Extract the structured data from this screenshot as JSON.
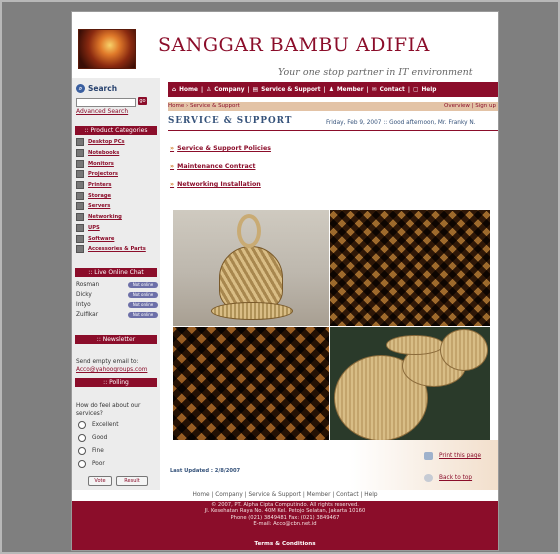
{
  "site": {
    "title": "SANGGAR BAMBU ADIFIA",
    "tagline": "Your one stop partner in IT environment"
  },
  "search": {
    "label": "Search",
    "go_label": "go",
    "advanced_label": "Advanced Search"
  },
  "categories": {
    "heading": ":: Product Categories",
    "items": [
      "Desktop PCs",
      "Notebooks",
      "Monitors",
      "Projectors",
      "Printers",
      "Storage",
      "Servers",
      "Networking",
      "UPS",
      "Software",
      "Accessories & Parts"
    ]
  },
  "chat": {
    "heading": ":: Live Online Chat",
    "users": [
      {
        "name": "Rosman",
        "status": "Not online"
      },
      {
        "name": "Dicky",
        "status": "Not online"
      },
      {
        "name": "Intyo",
        "status": "Not online"
      },
      {
        "name": "Zulfikar",
        "status": "Not online"
      }
    ]
  },
  "newsletter": {
    "heading": ":: Newsletter",
    "text": "Send empty email to:",
    "email": "Acco@yahoogroups.com"
  },
  "poll": {
    "heading": ":: Polling",
    "question": "How do feel about our services?",
    "options": [
      "Excellent",
      "Good",
      "Fine",
      "Poor"
    ],
    "vote_label": "Vote",
    "result_label": "Result"
  },
  "nav": {
    "items": [
      "Home",
      "Company",
      "Service & Support",
      "Member",
      "Contact",
      "Help"
    ]
  },
  "breadcrumb": {
    "home": "Home",
    "current": "Service & Support",
    "right": "Overview | Sign up"
  },
  "section": {
    "title": "SERVICE & SUPPORT",
    "date_line": "Friday, Feb 9, 2007 :: Good afternoon, Mr. Franky N.",
    "links": [
      "Service & Support Policies",
      "Maintenance Contract",
      "Networking Installation"
    ]
  },
  "page_footer": {
    "last_updated": "Last Updated : 2/8/2007",
    "print_label": "Print this page",
    "top_label": "Back to top"
  },
  "footer": {
    "links": "Home | Company | Service & Support | Member | Contact | Help",
    "copyright": "© 2007, PT. Alpha Cipta Computindo. All rights reserved.",
    "address": "Jl. Kesehatan Raya No. 40M Kel. Petojo Selatan, Jakarta 10160",
    "phone": "Phone (021) 3849481 Fax: (021) 3849467",
    "email": "E-mail: Acco@cbn.net.id",
    "terms": "Terms & Conditions"
  }
}
